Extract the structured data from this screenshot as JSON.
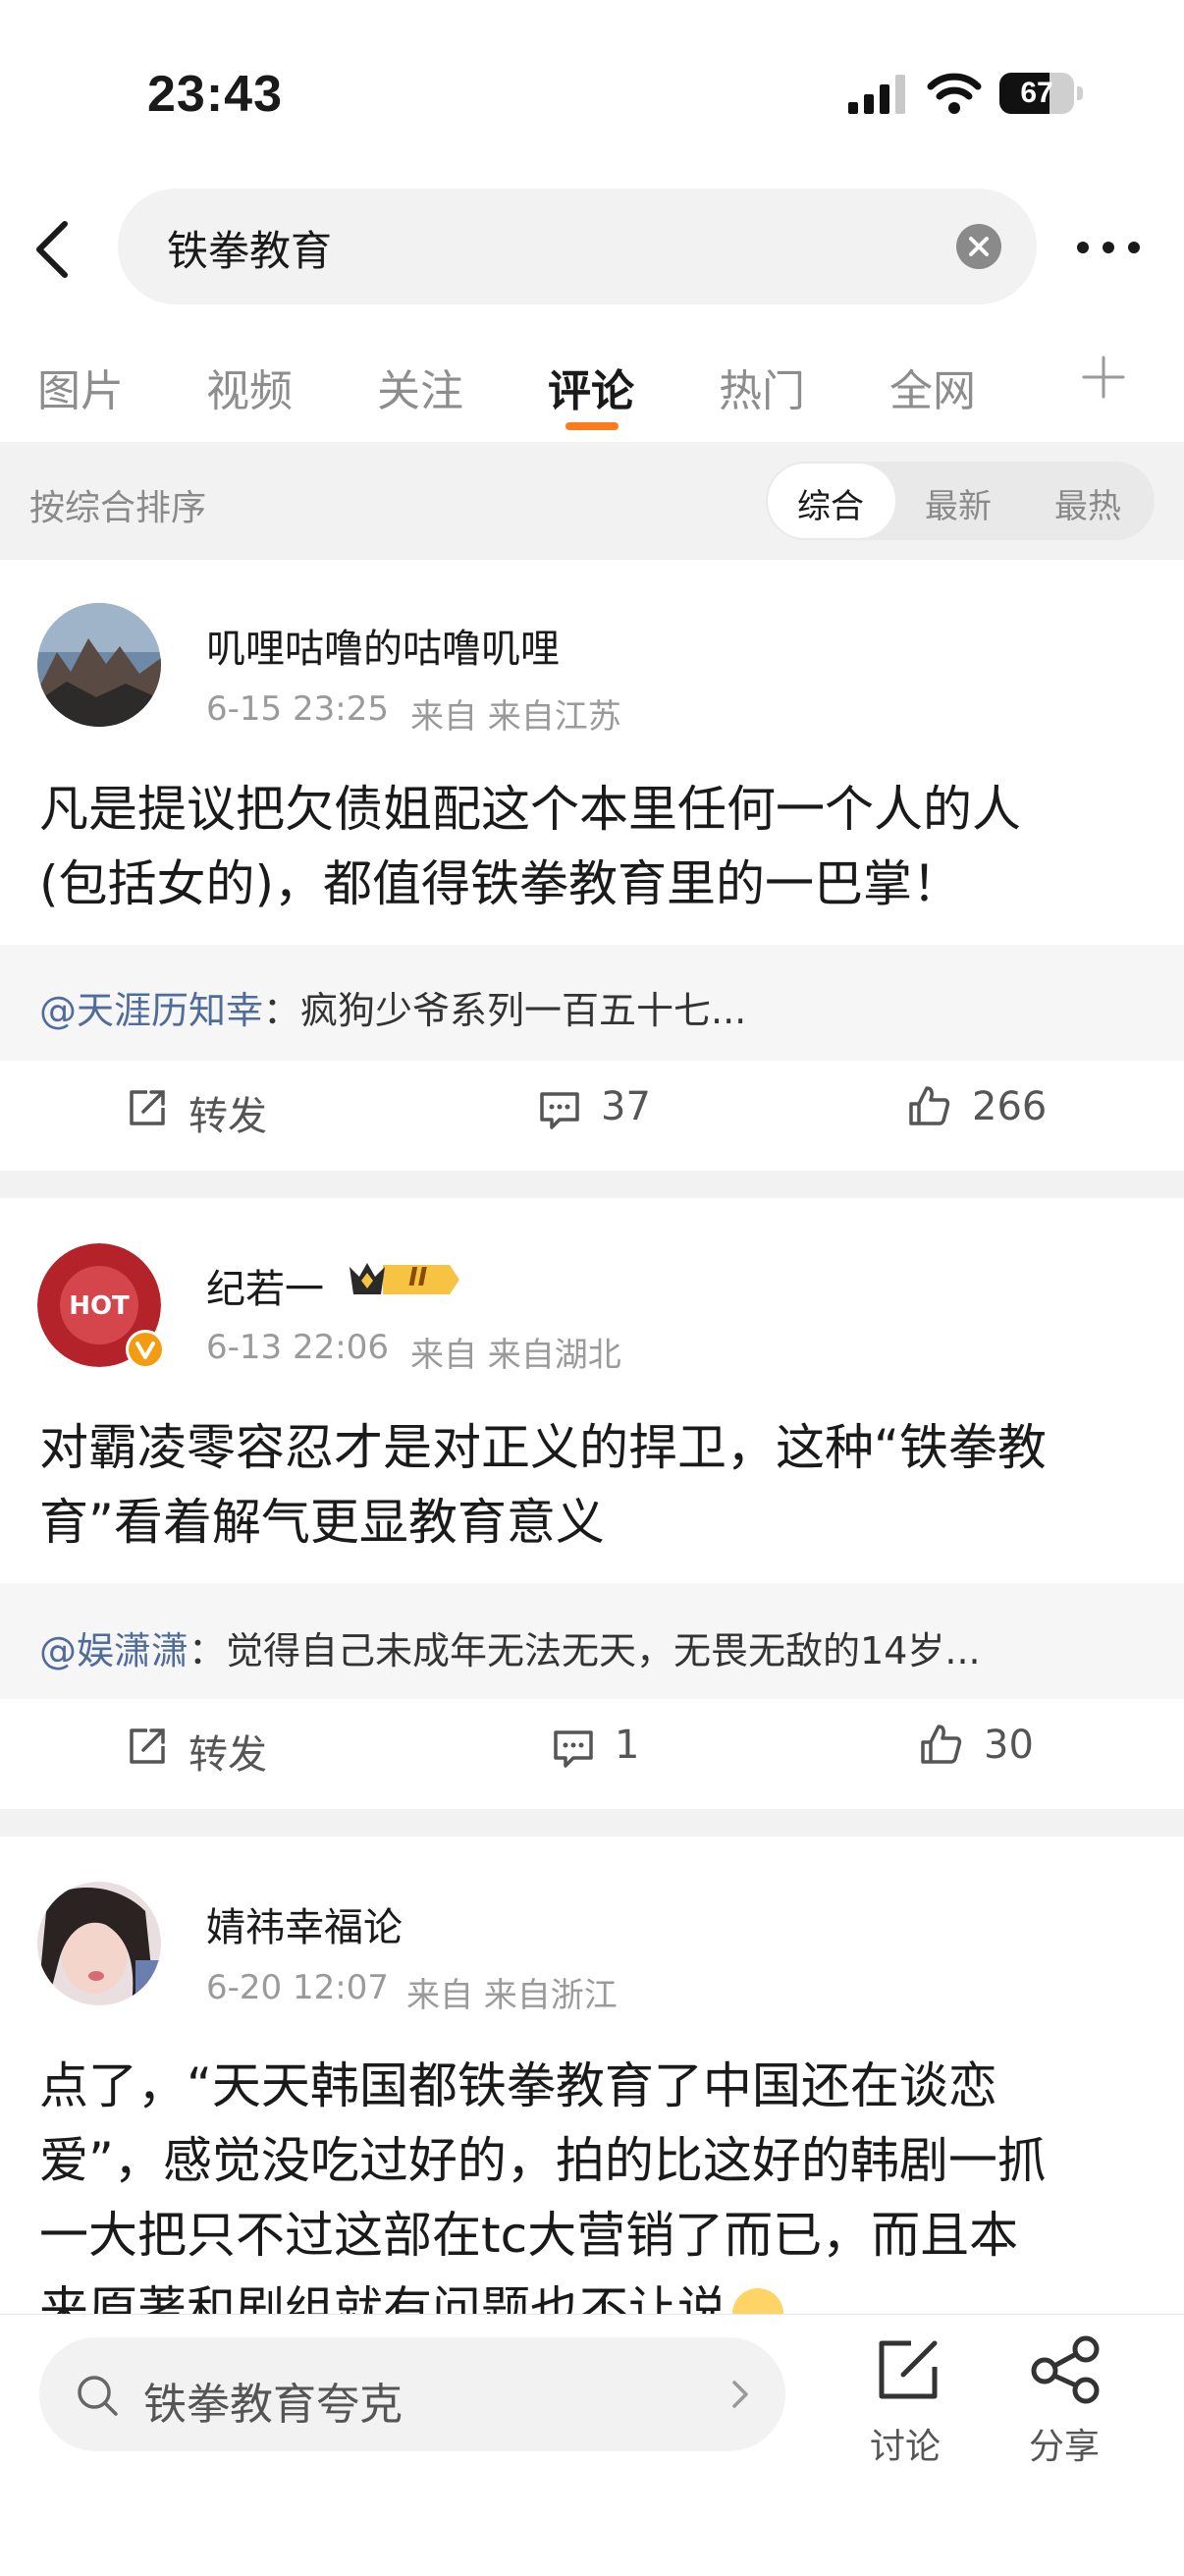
{
  "status_bar": {
    "time": "23:43",
    "battery": "67",
    "battery_level": 0.67
  },
  "search": {
    "query": "铁拳教育"
  },
  "tabs": [
    {
      "label": "图片",
      "active": false
    },
    {
      "label": "视频",
      "active": false
    },
    {
      "label": "关注",
      "active": false
    },
    {
      "label": "评论",
      "active": true
    },
    {
      "label": "热门",
      "active": false
    },
    {
      "label": "全网",
      "active": false
    }
  ],
  "sort": {
    "label": "按综合排序",
    "options": [
      "综合",
      "最新",
      "最热"
    ],
    "selected": "综合"
  },
  "posts": [
    {
      "username": "叽哩咕噜的咕噜叽哩",
      "date": "6-15 23:25",
      "source": "来自 来自江苏",
      "body_line1": "凡是提议把欠债姐配这个本里任何一个人的人",
      "body_line2": "(包括女的)，都值得铁拳教育里的一巴掌！",
      "quote_user": "@天涯历知幸",
      "quote_text": "：疯狗少爷系列一百五十七...",
      "repost_label": "转发",
      "comments": "37",
      "likes": "266"
    },
    {
      "username": "纪若一",
      "badge": "II",
      "avatar_text": "HOT",
      "date": "6-13 22:06",
      "source": "来自 来自湖北",
      "body_line1": "对霸凌零容忍才是对正义的捍卫，这种“铁拳教",
      "body_line2": "育”看着解气更显教育意义",
      "quote_user": "@娱潇潇",
      "quote_text": "：觉得自己未成年无法无天，无畏无敌的14岁...",
      "repost_label": "转发",
      "comments": "1",
      "likes": "30"
    },
    {
      "username": "婧祎幸福论",
      "date": "6-20 12:07",
      "source": "来自 来自浙江",
      "body_line1": "点了，“天天韩国都铁拳教育了中国还在谈恋",
      "body_line2": "爱”，感觉没吃过好的，拍的比这好的韩剧一抓",
      "body_line3": "一大把只不过这部在tc大营销了而已，而且本",
      "body_line4": "来原著和剧组就有问题也不让说"
    }
  ],
  "bottom_bar": {
    "search_text": "铁拳教育夸克",
    "discuss_label": "讨论",
    "share_label": "分享"
  },
  "colors": {
    "accent": "#ff7a1a",
    "link": "#4f6c9a",
    "muted": "#9a9a9a"
  }
}
